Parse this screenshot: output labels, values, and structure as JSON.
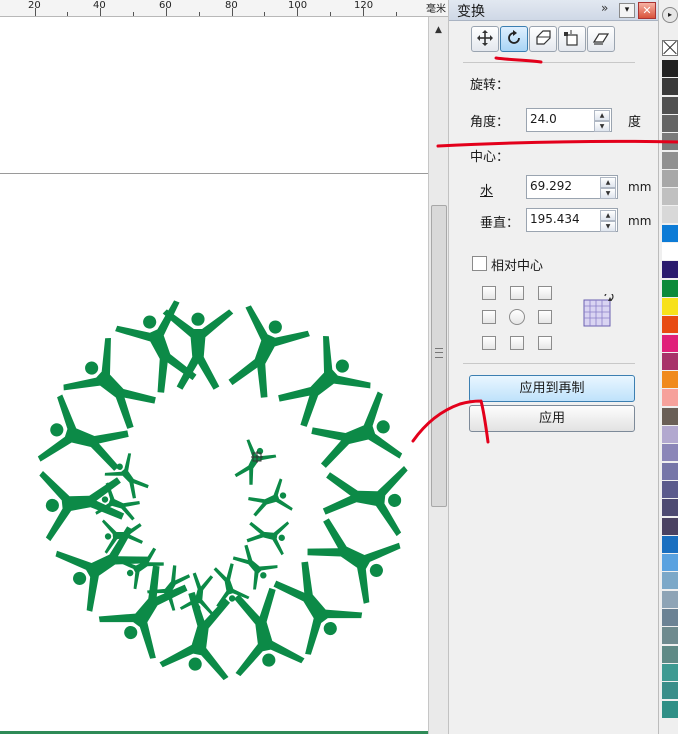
{
  "ruler": {
    "ticks": [
      "20",
      "40",
      "60",
      "80",
      "100",
      "120"
    ],
    "unit": "毫米"
  },
  "panel": {
    "title": "变换",
    "double_chevron": "»",
    "minimize_glyph": "▾",
    "close_glyph": "✕",
    "tool_buttons": [
      "position-icon",
      "rotate-icon",
      "scale-mirror-icon",
      "size-icon",
      "skew-icon"
    ],
    "rotate_section": "旋转：",
    "angle_label": "角度：",
    "angle_value": "24.0",
    "angle_unit": "度",
    "center_section": "中心：",
    "h_label": "水",
    "h_value": "69.292",
    "h_unit": "mm",
    "v_label": "垂直：",
    "v_value": "195.434",
    "v_unit": "mm",
    "relative_center_label": "相对中心",
    "relative_center_checked": false,
    "apply_duplicate_label": "应用到再制",
    "apply_label": "应用"
  },
  "palette": {
    "arrow_glyph": "▸",
    "colors": [
      "#222222",
      "#3a3a3a",
      "#505050",
      "#646464",
      "#7a7a7a",
      "#909090",
      "#a8a8a8",
      "#c0c0c0",
      "#d8d8d8",
      "#0c7bd6",
      "#ffffff",
      "#2a1b6e",
      "#0b8a3a",
      "#f7e11b",
      "#e84a12",
      "#e0207a",
      "#a8326a",
      "#f08a1c",
      "#f6a19b",
      "#6a5f57",
      "#b2a8cf",
      "#8b86b8",
      "#7676a8",
      "#5a5a8c",
      "#4d4a72",
      "#4a4262",
      "#1a6fc0",
      "#5aa2e0",
      "#7ca8c8",
      "#8ea4b6",
      "#6b8294",
      "#6e8a8e",
      "#5f8a86",
      "#3e9a92",
      "#3a8e8a",
      "#2f8f86"
    ]
  },
  "colors": {
    "figure_green": "#0c8a47",
    "annotation_red": "#e3001b",
    "accent_blue": "#3c7fb1"
  }
}
